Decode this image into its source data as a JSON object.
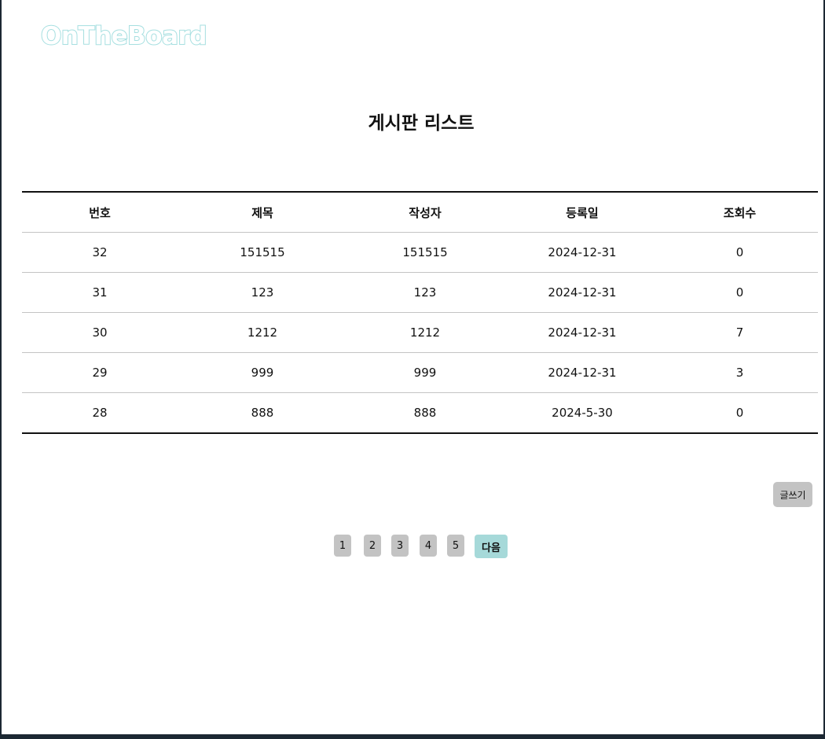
{
  "header": {
    "logo_text": "OnTheBoard"
  },
  "main": {
    "title": "게시판 리스트",
    "table": {
      "columns": [
        "번호",
        "제목",
        "작성자",
        "등록일",
        "조회수"
      ],
      "rows": [
        [
          "32",
          "151515",
          "151515",
          "2024-12-31",
          "0"
        ],
        [
          "31",
          "123",
          "123",
          "2024-12-31",
          "0"
        ],
        [
          "30",
          "1212",
          "1212",
          "2024-12-31",
          "7"
        ],
        [
          "29",
          "999",
          "999",
          "2024-12-31",
          "3"
        ],
        [
          "28",
          "888",
          "888",
          "2024-5-30",
          "0"
        ]
      ]
    },
    "write_button_label": "글쓰기",
    "pagination": {
      "pages": [
        "1",
        "2",
        "3",
        "4",
        "5"
      ],
      "next_label": "다음"
    }
  },
  "colors": {
    "logo_accent": "#a6dfe0",
    "next_button": "#a6d9d9",
    "page_button": "#c3c3c3"
  }
}
